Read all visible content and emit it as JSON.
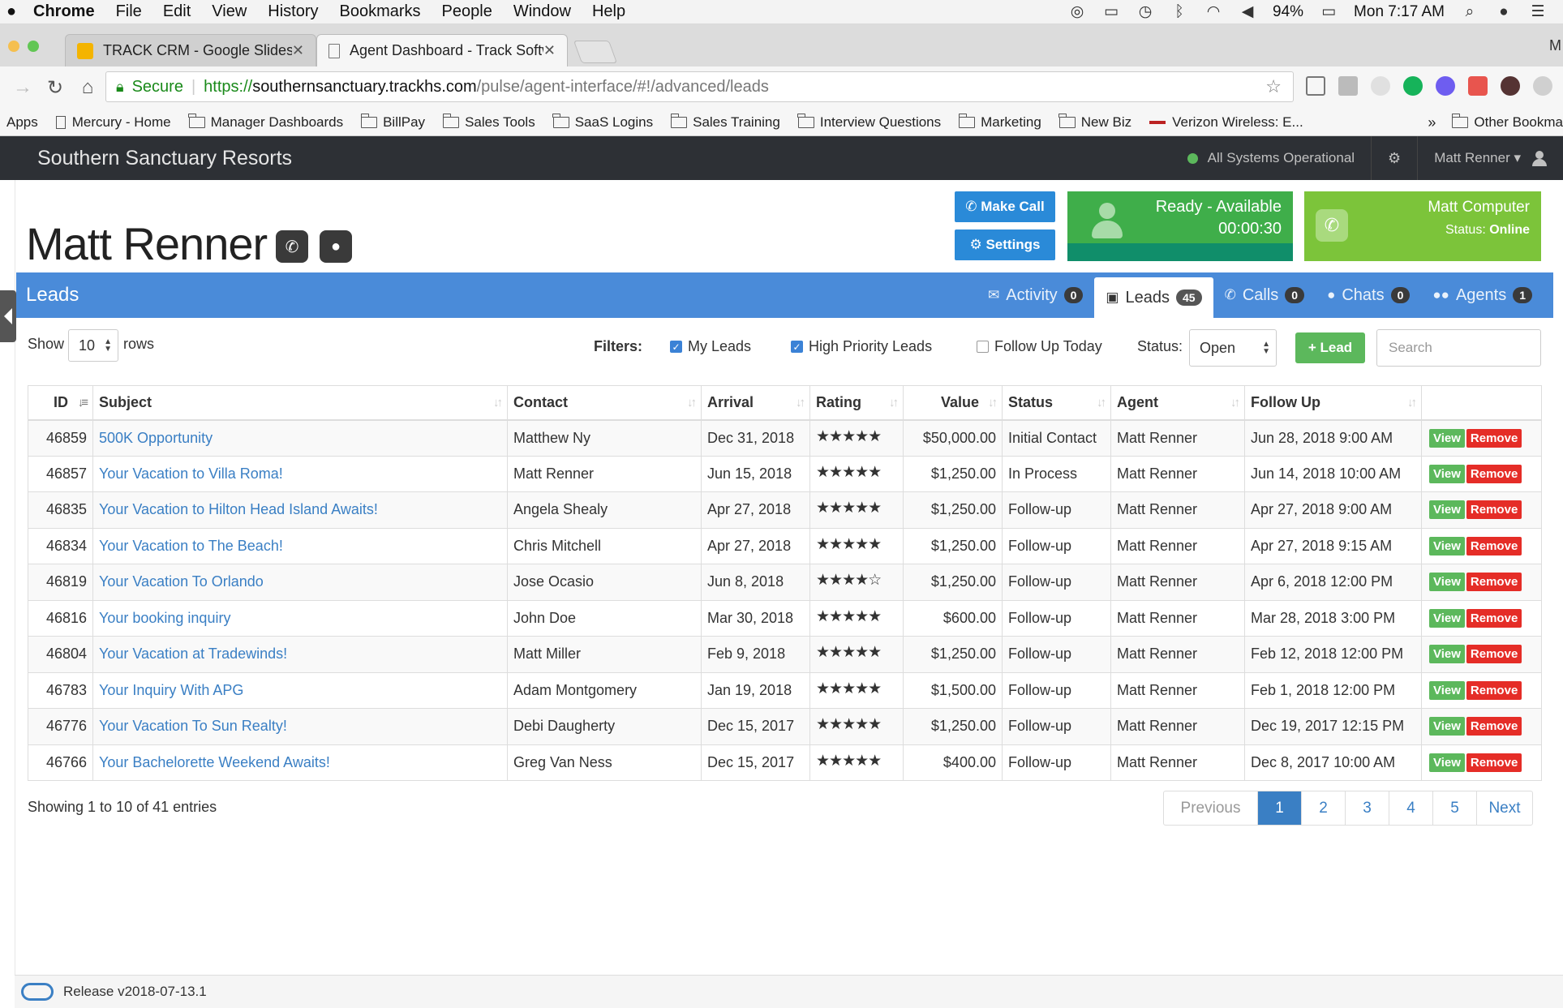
{
  "menubar": {
    "app": "Chrome",
    "items": [
      "File",
      "Edit",
      "View",
      "History",
      "Bookmarks",
      "People",
      "Window",
      "Help"
    ],
    "battery": "94%",
    "clock": "Mon 7:17 AM"
  },
  "tabs": [
    {
      "title": "TRACK CRM - Google Slides"
    },
    {
      "title": "Agent Dashboard - Track Softw"
    }
  ],
  "tabstrip_profile": "M",
  "address": {
    "secure_label": "Secure",
    "scheme": "https://",
    "host": "southernsanctuary.trackhs.com",
    "path": "/pulse/agent-interface/#!/advanced/leads"
  },
  "bookmarks": {
    "items": [
      {
        "label": "Apps",
        "icon": "none"
      },
      {
        "label": "Mercury - Home",
        "icon": "page"
      },
      {
        "label": "Manager Dashboards",
        "icon": "folder"
      },
      {
        "label": "BillPay",
        "icon": "folder"
      },
      {
        "label": "Sales Tools",
        "icon": "folder"
      },
      {
        "label": "SaaS Logins",
        "icon": "folder"
      },
      {
        "label": "Sales Training",
        "icon": "folder"
      },
      {
        "label": "Interview Questions",
        "icon": "folder"
      },
      {
        "label": "Marketing",
        "icon": "folder"
      },
      {
        "label": "New Biz",
        "icon": "folder"
      },
      {
        "label": "Verizon Wireless: E...",
        "icon": "dash"
      }
    ],
    "overflow": "»",
    "other": "Other Bookma"
  },
  "app": {
    "brand": "Southern Sanctuary Resorts",
    "system_status": "All Systems Operational",
    "user": "Matt Renner"
  },
  "agent": {
    "name": "Matt Renner",
    "make_call": "Make Call",
    "settings": "Settings",
    "ready_status": "Ready - Available",
    "ready_timer": "00:00:30",
    "computer_name": "Matt Computer",
    "computer_status_label": "Status:",
    "computer_status_value": "Online"
  },
  "leads_bar": {
    "title": "Leads",
    "tabs": [
      {
        "label": "Activity",
        "count": "0"
      },
      {
        "label": "Leads",
        "count": "45"
      },
      {
        "label": "Calls",
        "count": "0"
      },
      {
        "label": "Chats",
        "count": "0"
      },
      {
        "label": "Agents",
        "count": "1"
      }
    ]
  },
  "controls": {
    "show_label": "Show",
    "rows_value": "10",
    "rows_label": "rows",
    "filters_label": "Filters:",
    "filter_my_leads": "My Leads",
    "filter_high_priority": "High Priority Leads",
    "filter_follow_up": "Follow Up Today",
    "status_label": "Status:",
    "status_value": "Open",
    "add_lead": "Lead",
    "search_placeholder": "Search"
  },
  "table": {
    "columns": [
      "ID",
      "Subject",
      "Contact",
      "Arrival",
      "Rating",
      "Value",
      "Status",
      "Agent",
      "Follow Up"
    ],
    "view_label": "View",
    "remove_label": "Remove",
    "rows": [
      {
        "id": "46859",
        "subject": "500K Opportunity",
        "contact": "Matthew Ny",
        "arrival": "Dec 31, 2018",
        "rating": "★★★★★",
        "value": "$50,000.00",
        "status": "Initial Contact",
        "agent": "Matt Renner",
        "follow_up": "Jun 28, 2018 9:00 AM"
      },
      {
        "id": "46857",
        "subject": "Your Vacation to Villa Roma!",
        "contact": "Matt Renner",
        "arrival": "Jun 15, 2018",
        "rating": "★★★★★",
        "value": "$1,250.00",
        "status": "In Process",
        "agent": "Matt Renner",
        "follow_up": "Jun 14, 2018 10:00 AM"
      },
      {
        "id": "46835",
        "subject": "Your Vacation to Hilton Head Island Awaits!",
        "contact": "Angela Shealy",
        "arrival": "Apr 27, 2018",
        "rating": "★★★★★",
        "value": "$1,250.00",
        "status": "Follow-up",
        "agent": "Matt Renner",
        "follow_up": "Apr 27, 2018 9:00 AM"
      },
      {
        "id": "46834",
        "subject": "Your Vacation to The Beach!",
        "contact": "Chris Mitchell",
        "arrival": "Apr 27, 2018",
        "rating": "★★★★★",
        "value": "$1,250.00",
        "status": "Follow-up",
        "agent": "Matt Renner",
        "follow_up": "Apr 27, 2018 9:15 AM"
      },
      {
        "id": "46819",
        "subject": "Your Vacation To Orlando",
        "contact": "Jose Ocasio",
        "arrival": "Jun 8, 2018",
        "rating": "★★★★☆",
        "value": "$1,250.00",
        "status": "Follow-up",
        "agent": "Matt Renner",
        "follow_up": "Apr 6, 2018 12:00 PM"
      },
      {
        "id": "46816",
        "subject": "Your booking inquiry",
        "contact": "John Doe",
        "arrival": "Mar 30, 2018",
        "rating": "★★★★★",
        "value": "$600.00",
        "status": "Follow-up",
        "agent": "Matt Renner",
        "follow_up": "Mar 28, 2018 3:00 PM"
      },
      {
        "id": "46804",
        "subject": "Your Vacation at Tradewinds!",
        "contact": "Matt Miller",
        "arrival": "Feb 9, 2018",
        "rating": "★★★★★",
        "value": "$1,250.00",
        "status": "Follow-up",
        "agent": "Matt Renner",
        "follow_up": "Feb 12, 2018 12:00 PM"
      },
      {
        "id": "46783",
        "subject": "Your Inquiry With APG",
        "contact": "Adam Montgomery",
        "arrival": "Jan 19, 2018",
        "rating": "★★★★★",
        "value": "$1,500.00",
        "status": "Follow-up",
        "agent": "Matt Renner",
        "follow_up": "Feb 1, 2018 12:00 PM"
      },
      {
        "id": "46776",
        "subject": "Your Vacation To Sun Realty!",
        "contact": "Debi Daugherty",
        "arrival": "Dec 15, 2017",
        "rating": "★★★★★",
        "value": "$1,250.00",
        "status": "Follow-up",
        "agent": "Matt Renner",
        "follow_up": "Dec 19, 2017 12:15 PM"
      },
      {
        "id": "46766",
        "subject": "Your Bachelorette Weekend Awaits!",
        "contact": "Greg Van Ness",
        "arrival": "Dec 15, 2017",
        "rating": "★★★★★",
        "value": "$400.00",
        "status": "Follow-up",
        "agent": "Matt Renner",
        "follow_up": "Dec 8, 2017 10:00 AM"
      }
    ]
  },
  "pagination": {
    "summary": "Showing 1 to 10 of 41 entries",
    "previous": "Previous",
    "pages": [
      "1",
      "2",
      "3",
      "4",
      "5"
    ],
    "current": "1",
    "next": "Next"
  },
  "footer": {
    "release": "Release v2018-07-13.1"
  },
  "colors": {
    "leads_bar": "#4a8bd9",
    "ready_box": "#3fae4a",
    "computer_box": "#7cc43a",
    "appbar": "#2d3035",
    "link": "#3a7fc4",
    "view_button": "#5cb85c",
    "remove_button": "#e52d27"
  }
}
